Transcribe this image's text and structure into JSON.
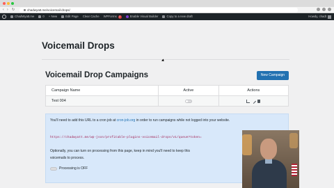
{
  "browser": {
    "url": "chadwyatt.me/voicemail-drops/"
  },
  "adminbar": {
    "site": "ChadWyatt.me",
    "comments": "0",
    "new": "+ New",
    "edit_page": "Edit Page",
    "clear_cache": "Clear Cache",
    "wpforms": "WPForms",
    "wpforms_badge": "2",
    "visual_builder": "Enable Visual Builder",
    "copy_draft": "Copy to a new draft",
    "howdy": "Howdy, chadt"
  },
  "page": {
    "title": "Voicemail Drops"
  },
  "campaigns": {
    "title": "Voicemail Drop Campaigns",
    "new_button": "New Campaign",
    "columns": [
      "Campaign Name",
      "Active",
      "Actions"
    ],
    "rows": [
      {
        "name": "Test 004",
        "active": false
      }
    ]
  },
  "info": {
    "line1_pre": "You'll need to add this URL to a cron job at ",
    "line1_link": "cron-job.org",
    "line1_post": " in order to run campaigns while not logged into your website.",
    "cron_url": "https://chadwyatt.me/wp-json/profitable-plugins-voicemail-drops/v1/queue?token=",
    "line2": "Optionally, you can turn on processing from this page, keep in mind you'll need to keep this",
    "line3": "voicemails to process.",
    "processing_label": "Processing is OFF"
  },
  "colors": {
    "primary": "#2271b1",
    "admin_bar": "#1d2327",
    "info_bg": "#d8e8fa",
    "code": "#a4285a"
  }
}
